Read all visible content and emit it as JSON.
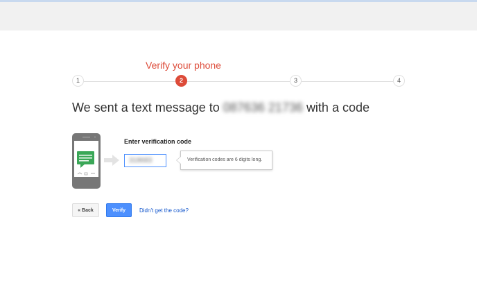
{
  "step_title": "Verify your phone",
  "steps": [
    {
      "label": "1",
      "active": false
    },
    {
      "label": "2",
      "active": true
    },
    {
      "label": "3",
      "active": false
    },
    {
      "label": "4",
      "active": false
    }
  ],
  "headline": {
    "prefix": "We sent a text message to",
    "phone_number": "087636 21736",
    "suffix": "with a code"
  },
  "code_field": {
    "label": "Enter verification code",
    "value": "318683"
  },
  "tooltip": "Verification codes are 6 digits long.",
  "buttons": {
    "back": "« Back",
    "verify": "Verify"
  },
  "resend_link": "Didn't get the code?",
  "colors": {
    "accent_red": "#dd4b39",
    "primary_blue": "#4d90fe",
    "link_blue": "#1155cc",
    "message_green": "#3aa757",
    "phone_gray": "#777777"
  },
  "icons": [
    "phone-message-icon",
    "arrow-right-icon"
  ]
}
